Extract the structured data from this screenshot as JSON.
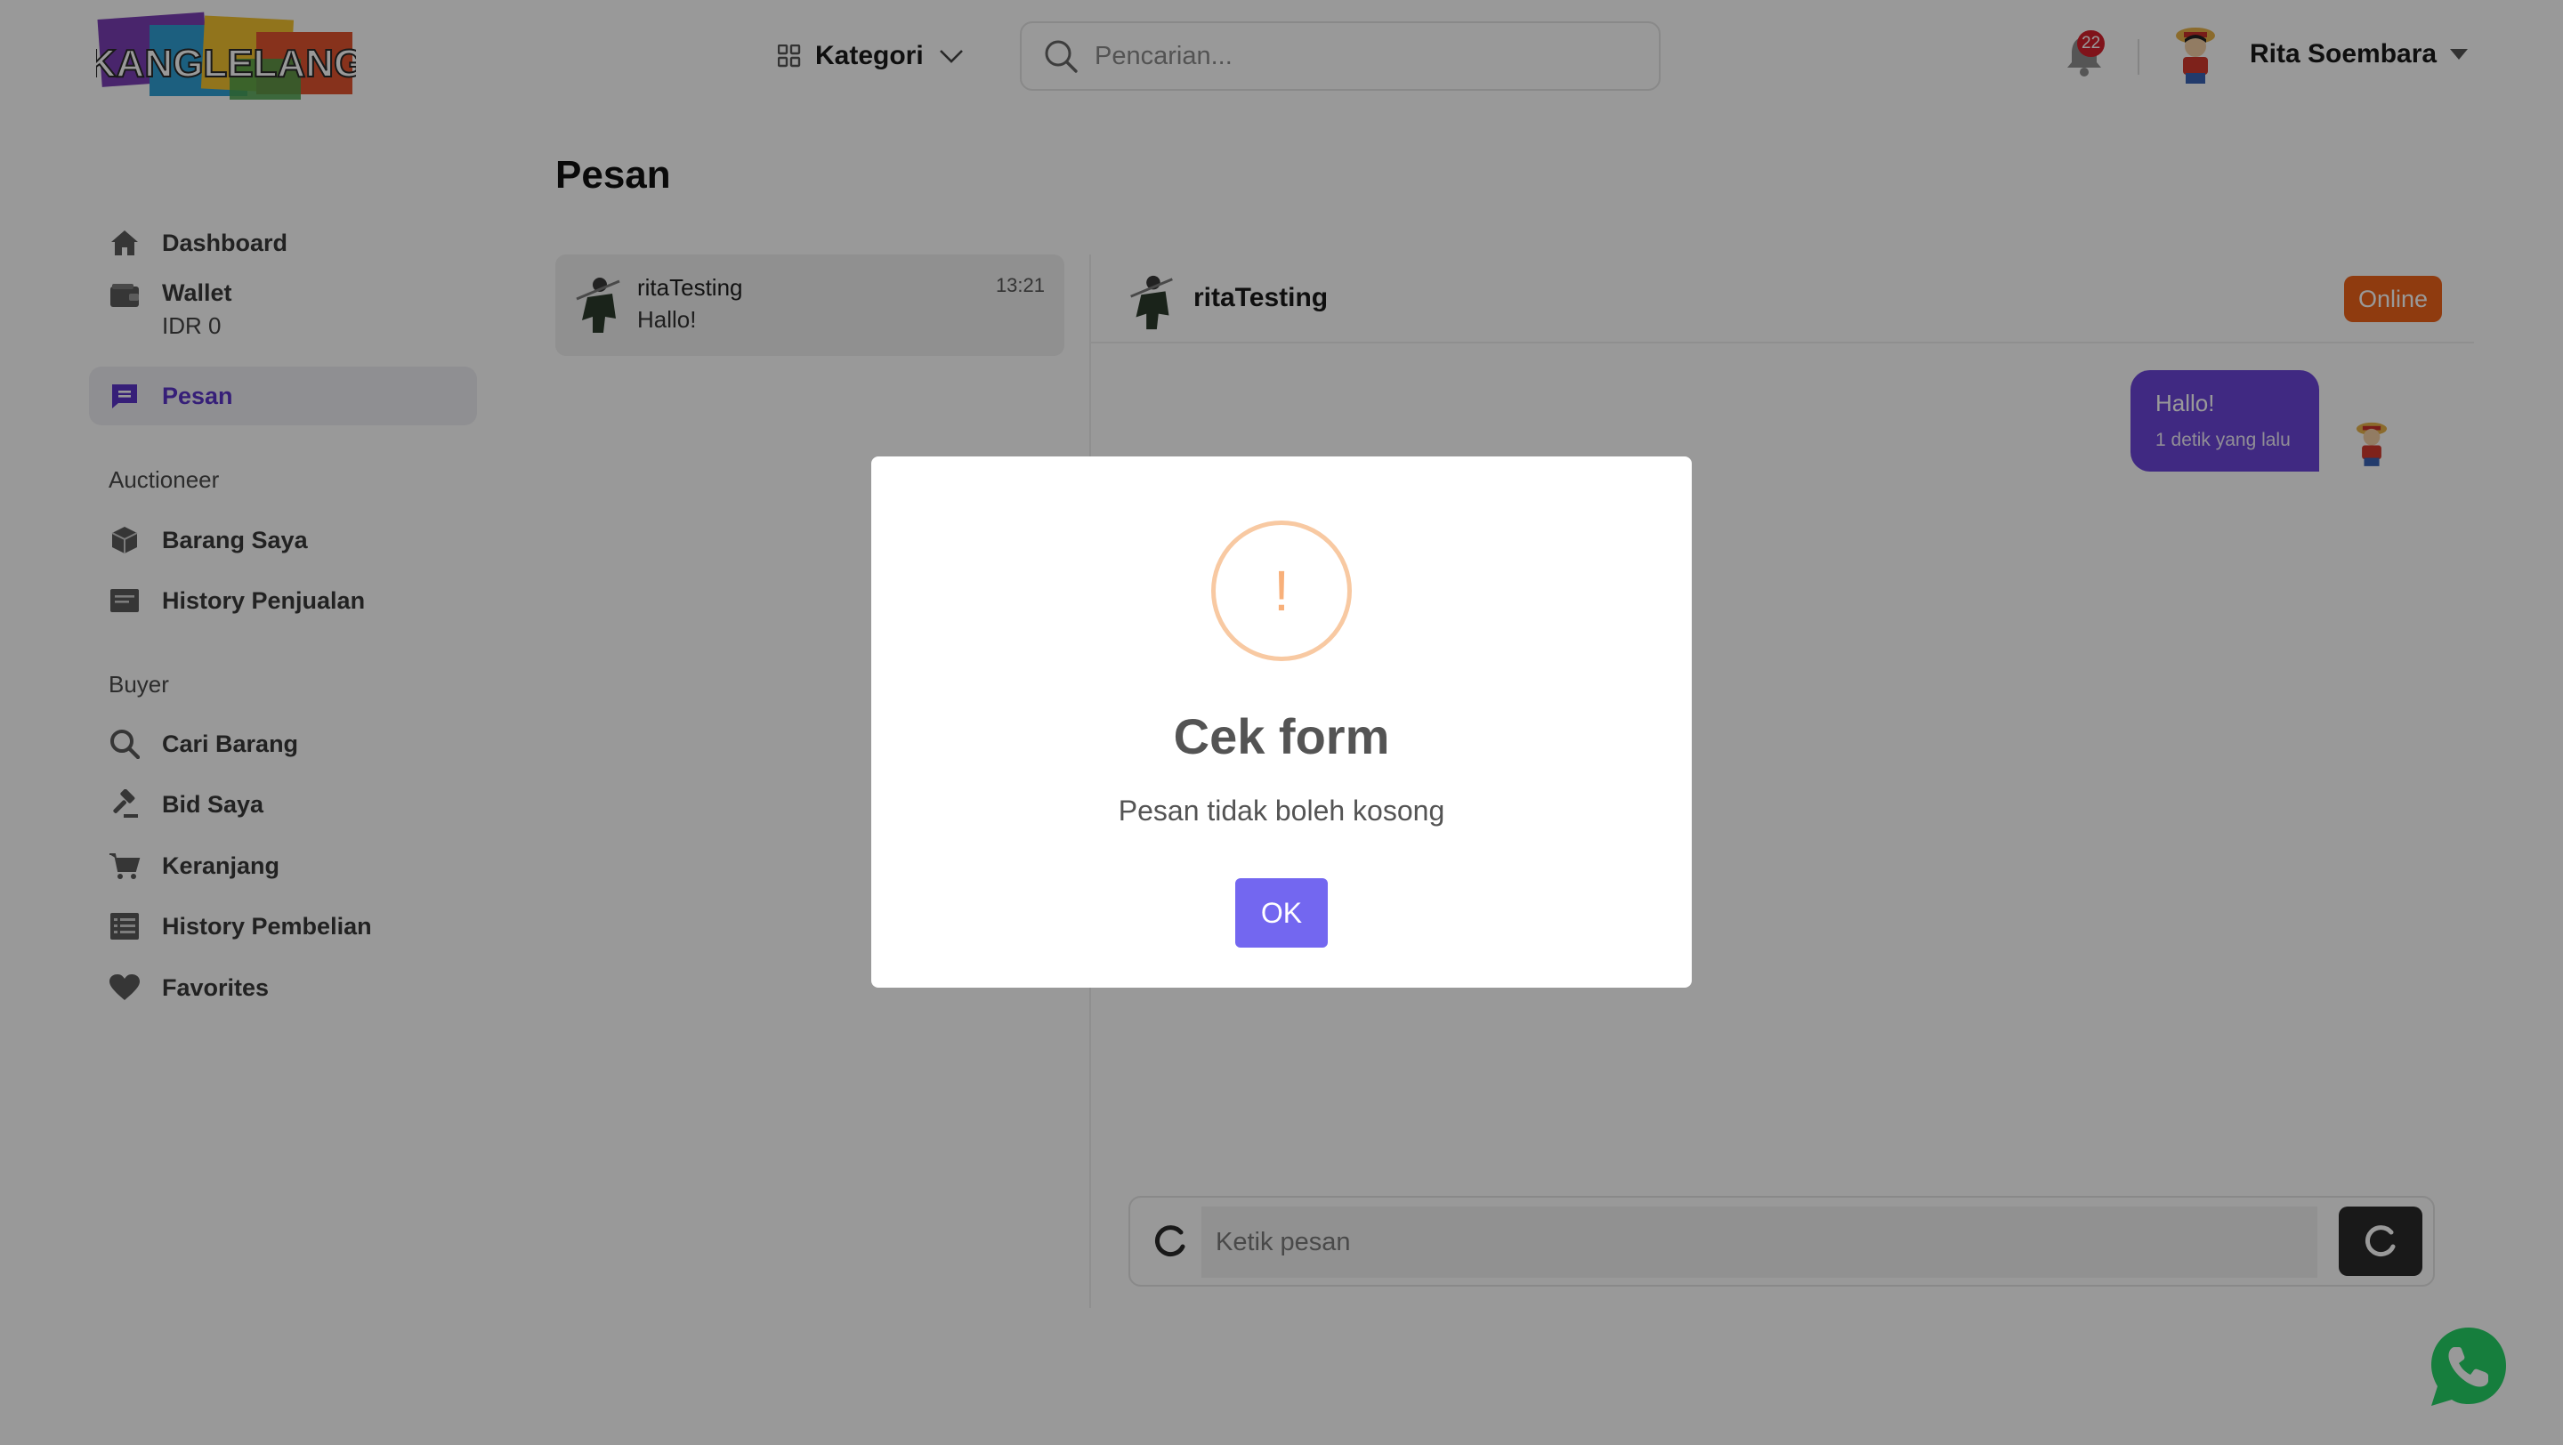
{
  "header": {
    "logo_text": "KANGLELANG",
    "kategori_label": "Kategori",
    "search_placeholder": "Pencarian...",
    "notification_count": "22",
    "username": "Rita Soembara"
  },
  "sidebar": {
    "dashboard": "Dashboard",
    "wallet": {
      "label": "Wallet",
      "balance": "IDR 0"
    },
    "pesan": "Pesan",
    "section_auctioneer": "Auctioneer",
    "barang_saya": "Barang Saya",
    "history_penjualan": "History Penjualan",
    "section_buyer": "Buyer",
    "cari_barang": "Cari Barang",
    "bid_saya": "Bid Saya",
    "keranjang": "Keranjang",
    "history_pembelian": "History Pembelian",
    "favorites": "Favorites"
  },
  "main": {
    "title": "Pesan",
    "conversation": {
      "name": "ritaTesting",
      "last_message": "Hallo!",
      "time": "13:21"
    },
    "chat": {
      "name": "ritaTesting",
      "status": "Online",
      "messages": [
        {
          "text": "Hallo!",
          "time": "1 detik yang lalu"
        }
      ],
      "input_placeholder": "Ketik pesan"
    }
  },
  "modal": {
    "icon": "!",
    "title": "Cek form",
    "text": "Pesan tidak boleh kosong",
    "ok_label": "OK"
  },
  "colors": {
    "accent": "#6b45d9",
    "online": "#ef6319",
    "modal_button": "#7367f0",
    "badge": "#d6202c"
  },
  "icons": [
    "grid-icon",
    "chevron-down-icon",
    "search-icon",
    "bell-icon",
    "home-icon",
    "wallet-icon",
    "chat-icon",
    "box-icon",
    "receipt-icon",
    "search-icon",
    "gavel-icon",
    "cart-icon",
    "list-icon",
    "heart-icon",
    "attach-icon",
    "send-icon",
    "whatsapp-icon",
    "warning-icon"
  ]
}
